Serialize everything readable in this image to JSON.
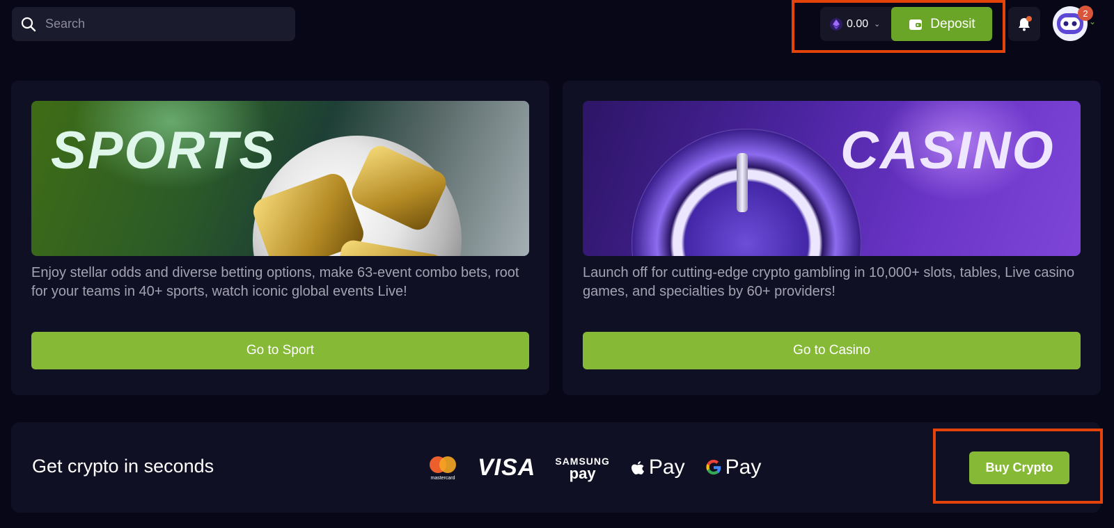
{
  "header": {
    "search_placeholder": "Search",
    "balance": "0.00",
    "deposit_label": "Deposit",
    "notification_badge": "2",
    "highlight_color": "#e5430c"
  },
  "cards": [
    {
      "banner_title": "SPORTS",
      "description": "Enjoy stellar odds and diverse betting options, make 63-event combo bets, root for your teams in 40+ sports, watch iconic global events Live!",
      "button_label": "Go to Sport"
    },
    {
      "banner_title": "CASINO",
      "description": "Launch off for cutting-edge crypto gambling in 10,000+ slots, tables, Live casino games, and specialties by 60+ providers!",
      "button_label": "Go to Casino"
    }
  ],
  "crypto_bar": {
    "title": "Get crypto in seconds",
    "payment_methods": {
      "mastercard": "mastercard",
      "visa": "VISA",
      "samsung_top": "SAMSUNG",
      "samsung_bottom": "pay",
      "apple_pay": "Pay",
      "google_pay": "Pay"
    },
    "buy_label": "Buy Crypto"
  },
  "colors": {
    "background": "#070717",
    "panel": "#101024",
    "accent_green": "#86b936",
    "deposit_green": "#6aa528"
  }
}
